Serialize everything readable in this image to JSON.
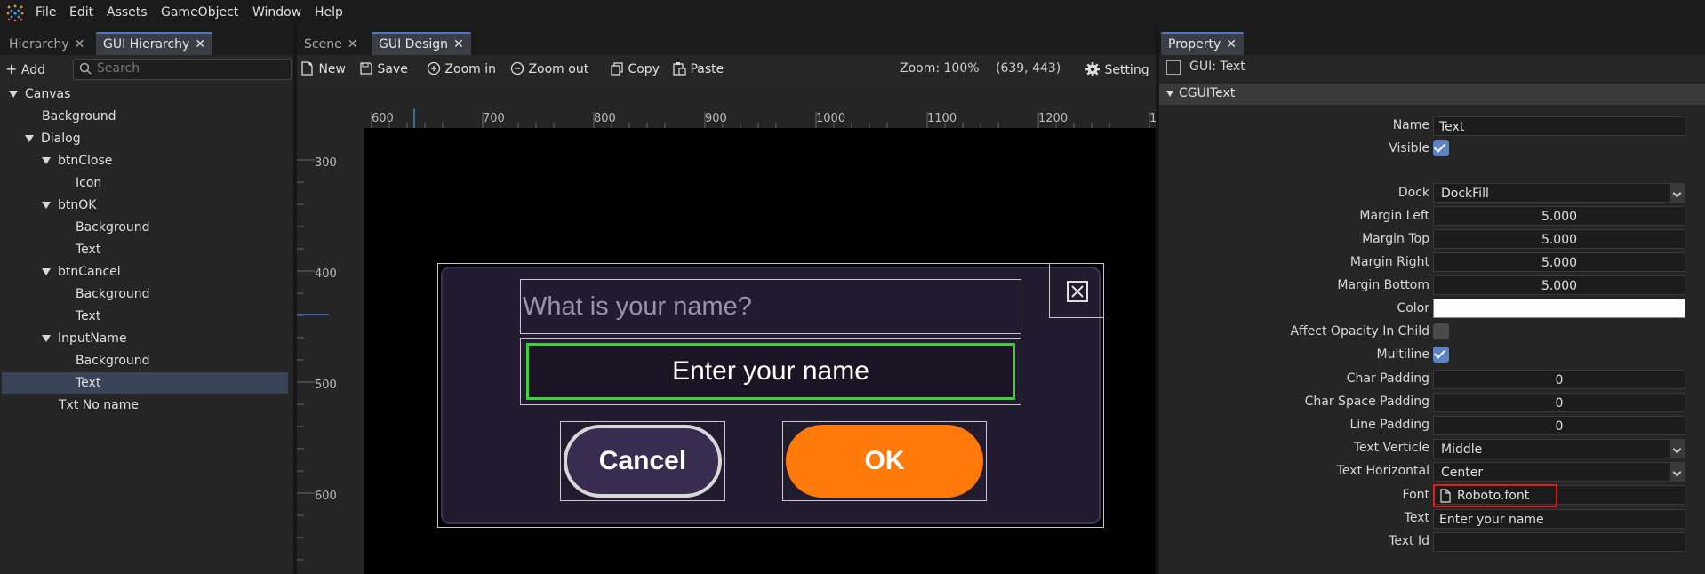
{
  "menubar": {
    "items": [
      "File",
      "Edit",
      "Assets",
      "GameObject",
      "Window",
      "Help"
    ]
  },
  "left_panel": {
    "tabs": [
      {
        "label": "Hierarchy"
      },
      {
        "label": "GUI Hierarchy"
      }
    ],
    "add_label": "Add",
    "search_placeholder": "Search",
    "tree": [
      {
        "label": "Canvas",
        "expanded": true
      },
      {
        "label": "Background"
      },
      {
        "label": "Dialog",
        "expanded": true
      },
      {
        "label": "btnClose",
        "expanded": true
      },
      {
        "label": "Icon"
      },
      {
        "label": "btnOK",
        "expanded": true
      },
      {
        "label": "Background"
      },
      {
        "label": "Text"
      },
      {
        "label": "btnCancel",
        "expanded": true
      },
      {
        "label": "Background"
      },
      {
        "label": "Text"
      },
      {
        "label": "InputName",
        "expanded": true
      },
      {
        "label": "Background"
      },
      {
        "label": "Text",
        "selected": true
      },
      {
        "label": "Txt No name"
      }
    ]
  },
  "center_panel": {
    "tabs": [
      {
        "label": "Scene"
      },
      {
        "label": "GUI Design"
      }
    ],
    "toolbar": {
      "new": "New",
      "save": "Save",
      "zoom_in": "Zoom in",
      "zoom_out": "Zoom out",
      "copy": "Copy",
      "paste": "Paste",
      "zoom_status": "Zoom: 100%",
      "coords": "(639, 443)",
      "setting": "Setting"
    },
    "ruler_h": [
      "600",
      "700",
      "800",
      "900",
      "1000",
      "1100",
      "1200",
      "1"
    ],
    "ruler_v": [
      "300",
      "400",
      "500",
      "600"
    ],
    "dialog": {
      "question": "What is your name?",
      "input_text": "Enter your name",
      "cancel_label": "Cancel",
      "ok_label": "OK"
    }
  },
  "right_panel": {
    "tabs": [
      {
        "label": "Property"
      }
    ],
    "object_label": "GUI: Text",
    "section": "CGUIText",
    "fields": {
      "name": {
        "label": "Name",
        "value": "Text"
      },
      "visible": {
        "label": "Visible",
        "checked": true
      },
      "dock": {
        "label": "Dock",
        "value": "DockFill"
      },
      "margin_left": {
        "label": "Margin Left",
        "value": "5.000"
      },
      "margin_top": {
        "label": "Margin Top",
        "value": "5.000"
      },
      "margin_right": {
        "label": "Margin Right",
        "value": "5.000"
      },
      "margin_bottom": {
        "label": "Margin Bottom",
        "value": "5.000"
      },
      "color": {
        "label": "Color",
        "value": "#ffffff"
      },
      "affect_opacity": {
        "label": "Affect Opacity In Child",
        "checked": false
      },
      "multiline": {
        "label": "Multiline",
        "checked": true
      },
      "char_padding": {
        "label": "Char Padding",
        "value": "0"
      },
      "char_space_padding": {
        "label": "Char Space Padding",
        "value": "0"
      },
      "line_padding": {
        "label": "Line Padding",
        "value": "0"
      },
      "text_verticle": {
        "label": "Text Verticle",
        "value": "Middle"
      },
      "text_horizontal": {
        "label": "Text Horizontal",
        "value": "Center"
      },
      "font": {
        "label": "Font",
        "value": "Roboto.font"
      },
      "text": {
        "label": "Text",
        "value": "Enter your name"
      },
      "text_id": {
        "label": "Text Id",
        "value": ""
      }
    }
  },
  "colors": {
    "accent_blue": "#4a7ac0",
    "ok_orange": "#ff7a0a",
    "input_green": "#3cd13c",
    "dialog_bg": "#221a2e",
    "highlight_red": "#e02020"
  }
}
